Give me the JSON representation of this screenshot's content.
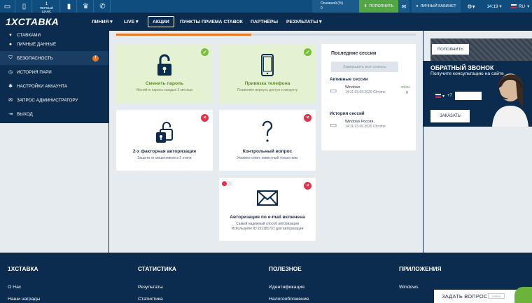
{
  "topbar": {
    "promo_line1": "ПЕРВЫЙ",
    "promo_line2": "ШАНС",
    "promo_count": "1",
    "balance_label": "Основной (%)",
    "balance_value": "0",
    "deposit_label": "ПОПОЛНИТЬ",
    "cabinet_label": "ЛИЧНЫЙ КАБИНЕТ",
    "time": "14:19",
    "language": "RU"
  },
  "nav": {
    "logo": "1XСТАВКА",
    "items": [
      {
        "label": "ЛИНИЯ"
      },
      {
        "label": "LIVE"
      },
      {
        "label": "АКЦИИ"
      },
      {
        "label": "ПУНКТЫ ПРИЕМА СТАВОК"
      },
      {
        "label": "ПАРТНЁРЫ"
      },
      {
        "label": "РЕЗУЛЬТАТЫ"
      }
    ]
  },
  "sidebar": {
    "items": [
      {
        "label": "СТАВКАМИ"
      },
      {
        "label": "ЛИЧНЫЕ ДАННЫЕ"
      },
      {
        "label": "БЕЗОПАСНОСТЬ"
      },
      {
        "label": "ИСТОРИЯ ПАРИ"
      },
      {
        "label": "НАСТРОЙКИ АККАУНТА"
      },
      {
        "label": "ЗАПРОС АДМИНИСТРАТОРУ"
      },
      {
        "label": "ВЫХОД"
      }
    ]
  },
  "security": {
    "progress": 0.45,
    "cards": [
      {
        "title": "Сменить пароль",
        "subtitle": "Меняйте пароль каждые 3 месяца"
      },
      {
        "title": "Привязка телефона",
        "subtitle": "Позволяет вернуть доступ к аккаунту"
      },
      {
        "title": "2-х факторная авторизация",
        "subtitle": "Защита от мошенников в 2 этапа"
      },
      {
        "title": "Контрольный вопрос",
        "subtitle": "Укажите ответ, известный только вам"
      },
      {
        "title": "Авторизация по e-mail включена",
        "subtitle_line1": "Самый надежный способ авторизации",
        "subtitle_line2": "Используйте ID 221181731 для авторизации"
      }
    ]
  },
  "sessions": {
    "title": "Последние сессии",
    "end_all": "Завершить все сеансы",
    "active_title": "Активные сессии",
    "active": {
      "name": "Windows",
      "time": "14:11 23.09.2020 Chrome",
      "status": "online"
    },
    "history_title": "История сессий",
    "history": {
      "name": "Windows Россия ,",
      "time": "14:11 23.09.2020 Chrome"
    }
  },
  "right_rail": {
    "deposit_button": "ПОПОЛНИТЬ",
    "callback_title": "ОБРАТНЫЙ ЗВОНОК",
    "callback_subtitle": "Получите консультацию на сайте",
    "phone_code": "+7",
    "order_button": "ЗАКАЗАТЬ"
  },
  "footer": {
    "columns": [
      {
        "title": "1XСТАВКА",
        "links": [
          "О Нас",
          "Наши награды"
        ]
      },
      {
        "title": "СТАТИСТИКА",
        "links": [
          "Результаты",
          "Статистика"
        ]
      },
      {
        "title": "ПОЛЕЗНОЕ",
        "links": [
          "Идентификация",
          "Налогообложение"
        ]
      },
      {
        "title": "ПРИЛОЖЕНИЯ",
        "links": [
          "Windows"
        ]
      }
    ],
    "ask_label": "ЗАДАТЬ ВОПРОС",
    "ask_status": "online"
  },
  "colors": {
    "nav_bg": "#0b2c4f",
    "topbar_bg": "#0e4d7e",
    "deposit_green": "#53a546",
    "accent_orange": "#e47a27",
    "success_green": "#7bbf3e",
    "danger_red": "#e0334c"
  },
  "icons": [
    "desktop-icon",
    "mobile-icon",
    "stats-icon",
    "trophy-icon",
    "phone-icon",
    "download-icon",
    "mail-icon",
    "user-icon",
    "gear-icon",
    "lock-icon",
    "smartphone-icon",
    "two-factor-lock-icon",
    "question-icon",
    "envelope-icon",
    "monitor-icon"
  ]
}
